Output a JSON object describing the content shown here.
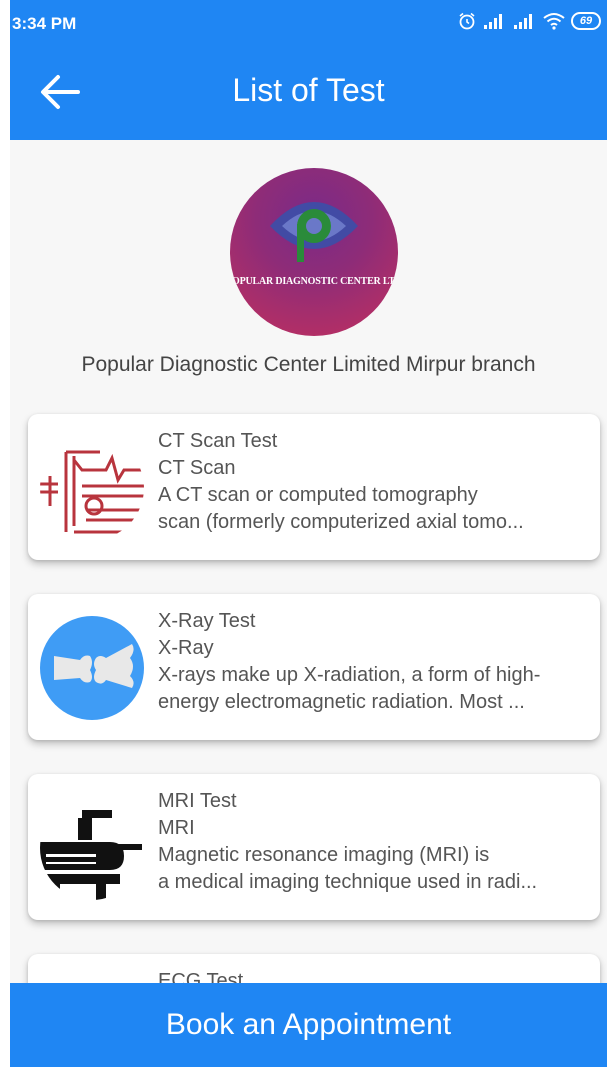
{
  "status_bar": {
    "time": "3:34 PM",
    "battery": "69",
    "icons": [
      "alarm-icon",
      "signal-icon",
      "signal-icon",
      "wifi-icon",
      "battery-icon"
    ]
  },
  "app_bar": {
    "title": "List of Test",
    "back_icon": "arrow-left-icon"
  },
  "center": {
    "logo_text": "POPULAR DIAGNOSTIC CENTER LTD",
    "name": "Popular Diagnostic Center Limited Mirpur branch"
  },
  "tests": [
    {
      "title": "CT Scan Test",
      "type": "CT Scan",
      "desc_line1": "A CT scan or computed tomography",
      "desc_line2": "scan (formerly computerized axial tomo...",
      "icon": "ct-scanner-icon"
    },
    {
      "title": "X-Ray Test",
      "type": "X-Ray",
      "desc_line1": "X-rays make up X-radiation, a form of high-",
      "desc_line2": "energy electromagnetic radiation. Most ...",
      "icon": "bone-xray-icon"
    },
    {
      "title": "MRI Test",
      "type": "MRI",
      "desc_line1": "Magnetic resonance imaging (MRI) is",
      "desc_line2": "a medical imaging technique used in radi...",
      "icon": "mri-machine-icon"
    },
    {
      "title": "ECG Test"
    }
  ],
  "book_button": {
    "label": "Book an Appointment"
  },
  "colors": {
    "primary": "#1f86f3",
    "ct_icon": "#b8343d",
    "xray_icon": "#3f9cf5"
  }
}
